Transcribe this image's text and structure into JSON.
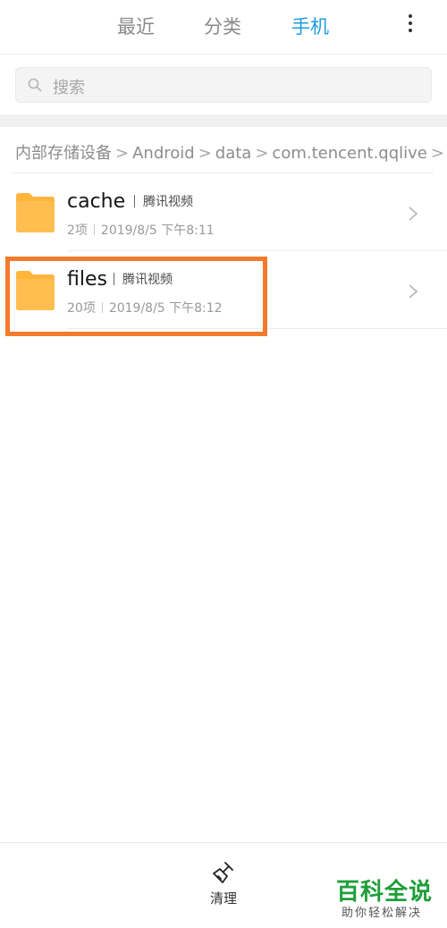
{
  "tabs": [
    {
      "label": "最近",
      "active": false
    },
    {
      "label": "分类",
      "active": false
    },
    {
      "label": "手机",
      "active": true
    }
  ],
  "search": {
    "placeholder": "搜索"
  },
  "breadcrumb": [
    "内部存储设备",
    "Android",
    "data",
    "com.tencent.qqlive"
  ],
  "files": [
    {
      "name": "cache",
      "app": "腾讯视频",
      "count": "2项",
      "date": "2019/8/5 下午8:11"
    },
    {
      "name": "files",
      "app": "腾讯视频",
      "count": "20项",
      "date": "2019/8/5 下午8:12"
    }
  ],
  "bottom": {
    "clean_label": "清理"
  },
  "watermark": {
    "title": "百科全说",
    "subtitle": "助你轻松解决"
  },
  "colors": {
    "accent": "#1e9be0",
    "folder": "#ffb53c",
    "highlight": "#f47a2c",
    "watermark": "#1e9e3a"
  }
}
